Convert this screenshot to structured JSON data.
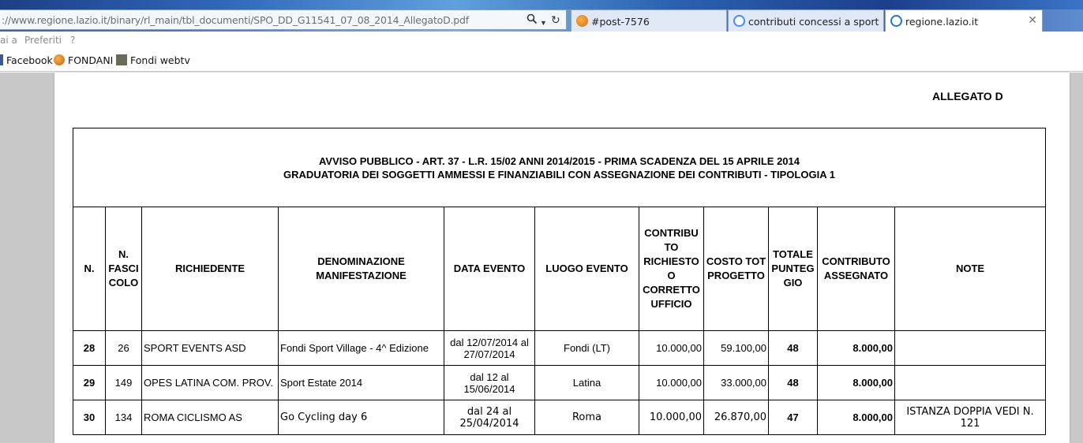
{
  "browser": {
    "address": "://www.regione.lazio.it/binary/rl_main/tbl_documenti/SPO_DD_G11541_07_08_2014_AllegatoD.pdf",
    "tabs": [
      {
        "label": "#post-7576"
      },
      {
        "label": "contributi concessi a sport eve..."
      },
      {
        "label": "regione.lazio.it"
      }
    ],
    "menu": [
      "ai a",
      "Preferiti",
      "?"
    ],
    "favorites": [
      "Facebook",
      "FONDANI",
      "Fondi webtv"
    ]
  },
  "document": {
    "allegato": "ALLEGATO D",
    "title_line1": "AVVISO PUBBLICO -  ART. 37  -  L.R. 15/02 ANNI 2014/2015 - PRIMA SCADENZA DEL 15 APRILE 2014",
    "title_line2": "GRADUATORIA DEI SOGGETTI AMMESSI E FINANZIABILI CON ASSEGNAZIONE DEI CONTRIBUTI  - TIPOLOGIA 1",
    "headers": {
      "n": "N.",
      "fascicolo": "N. FASCI COLO",
      "richiedente": "RICHIEDENTE",
      "denominazione": "DENOMINAZIONE MANIFESTAZIONE",
      "data": "DATA EVENTO",
      "luogo": "LUOGO EVENTO",
      "contributo_richiesto": "CONTRIBU TO RICHIESTO O CORRETTO UFFICIO",
      "costo": "COSTO TOT PROGETTO",
      "punteggio": "TOTALE PUNTEG GIO",
      "assegnato": "CONTRIBUTO ASSEGNATO",
      "note": "NOTE"
    },
    "rows": [
      {
        "n": "28",
        "fascicolo": "26",
        "richiedente": "SPORT EVENTS ASD",
        "denominazione": "Fondi Sport Village - 4^ Edizione",
        "data": "dal 12/07/2014 al 27/07/2014",
        "luogo": "Fondi (LT)",
        "richiesto": "10.000,00",
        "costo": "59.100,00",
        "punteggio": "48",
        "assegnato": "8.000,00",
        "note": ""
      },
      {
        "n": "29",
        "fascicolo": "149",
        "richiedente": "OPES LATINA COM. PROV.",
        "denominazione": "Sport Estate 2014",
        "data": "dal 12 al 15/06/2014",
        "luogo": "Latina",
        "richiesto": "10.000,00",
        "costo": "33.000,00",
        "punteggio": "48",
        "assegnato": "8.000,00",
        "note": ""
      },
      {
        "n": "30",
        "fascicolo": "134",
        "richiedente": "ROMA CICLISMO AS",
        "denominazione": "Go Cycling day 6",
        "data": "dal 24 al 25/04/2014",
        "luogo": "Roma",
        "richiesto": "10.000,00",
        "costo": "26.870,00",
        "punteggio": "47",
        "assegnato": "8.000,00",
        "note": "ISTANZA DOPPIA VEDI N. 121"
      }
    ]
  }
}
